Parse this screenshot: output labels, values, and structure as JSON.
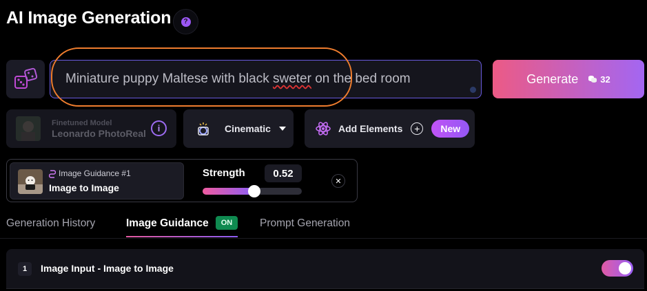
{
  "header": {
    "title": "AI Image Generation",
    "help_icon": "question-icon"
  },
  "prompt": {
    "dice_icon": "dice-icon",
    "text_before": "Miniature puppy Maltese with black ",
    "text_misspelled": "sweter",
    "text_after": " on the bed room",
    "generate_label": "Generate",
    "cost": "32",
    "cost_icon": "coins-icon"
  },
  "options": {
    "model_caption": "Finetuned Model",
    "model_name": "Leonardo PhotoReal",
    "style_label": "Cinematic",
    "elements_label": "Add Elements",
    "new_badge": "New"
  },
  "guidance_card": {
    "caption": "Image Guidance #1",
    "mode": "Image to Image",
    "strength_label": "Strength",
    "strength_value": "0.52",
    "strength_fraction": 0.52
  },
  "tabs": [
    {
      "label": "Generation History"
    },
    {
      "label": "Image Guidance",
      "badge": "ON"
    },
    {
      "label": "Prompt Generation"
    }
  ],
  "step": {
    "number": "1",
    "label": "Image Input - Image to Image",
    "toggle_on": true
  },
  "colors": {
    "accent_orange": "#ef7d2e",
    "accent_purple": "#9b57f5",
    "accent_pink": "#ec5a85",
    "on_green": "#0f8a50"
  }
}
